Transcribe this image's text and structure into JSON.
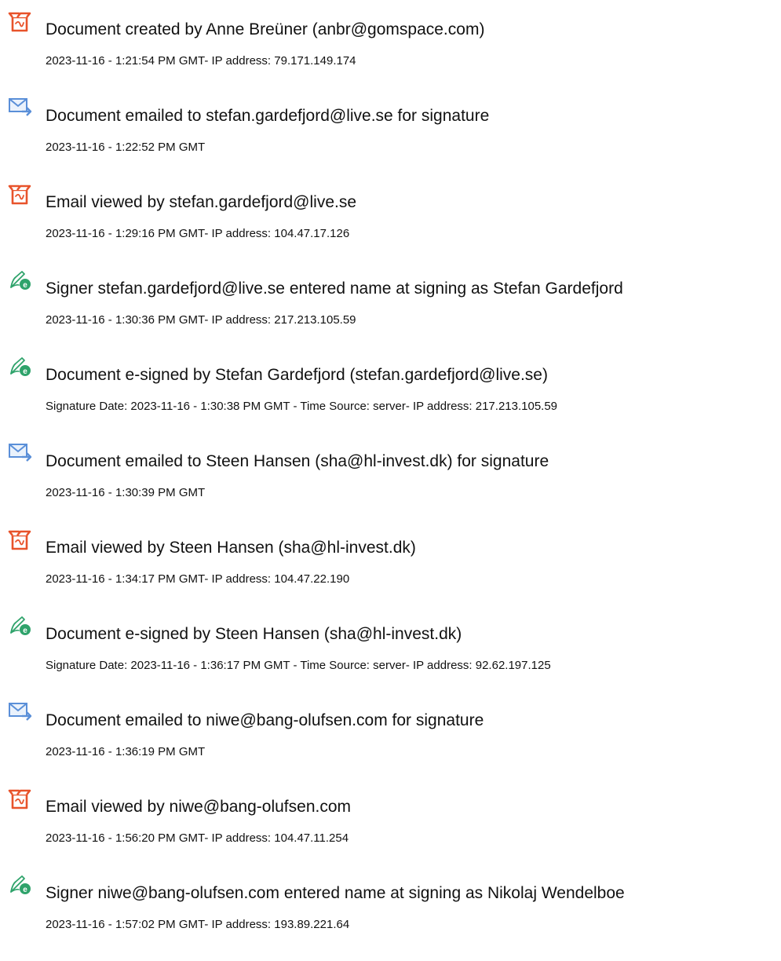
{
  "audit_trail": {
    "events": [
      {
        "icon": "document-created-icon",
        "title": "Document created by Anne Breüner (anbr@gomspace.com)",
        "detail": "2023-11-16 - 1:21:54 PM GMT- IP address: 79.171.149.174"
      },
      {
        "icon": "email-sent-icon",
        "title": "Document emailed to stefan.gardefjord@live.se for signature",
        "detail": "2023-11-16 - 1:22:52 PM GMT"
      },
      {
        "icon": "document-viewed-icon",
        "title": "Email viewed by stefan.gardefjord@live.se",
        "detail": "2023-11-16 - 1:29:16 PM GMT- IP address: 104.47.17.126"
      },
      {
        "icon": "e-sign-icon",
        "title": "Signer stefan.gardefjord@live.se entered name at signing as Stefan Gardefjord",
        "detail": "2023-11-16 - 1:30:36 PM GMT- IP address: 217.213.105.59"
      },
      {
        "icon": "e-sign-icon",
        "title": "Document e-signed by Stefan Gardefjord (stefan.gardefjord@live.se)",
        "detail": "Signature Date: 2023-11-16 - 1:30:38 PM GMT - Time Source: server- IP address: 217.213.105.59"
      },
      {
        "icon": "email-sent-icon",
        "title": "Document emailed to Steen Hansen (sha@hl-invest.dk) for signature",
        "detail": "2023-11-16 - 1:30:39 PM GMT"
      },
      {
        "icon": "document-viewed-icon",
        "title": "Email viewed by Steen Hansen (sha@hl-invest.dk)",
        "detail": "2023-11-16 - 1:34:17 PM GMT- IP address: 104.47.22.190"
      },
      {
        "icon": "e-sign-icon",
        "title": "Document e-signed by Steen Hansen (sha@hl-invest.dk)",
        "detail": "Signature Date: 2023-11-16 - 1:36:17 PM GMT - Time Source: server- IP address: 92.62.197.125"
      },
      {
        "icon": "email-sent-icon",
        "title": "Document emailed to niwe@bang-olufsen.com for signature",
        "detail": "2023-11-16 - 1:36:19 PM GMT"
      },
      {
        "icon": "document-viewed-icon",
        "title": "Email viewed by niwe@bang-olufsen.com",
        "detail": "2023-11-16 - 1:56:20 PM GMT- IP address: 104.47.11.254"
      },
      {
        "icon": "e-sign-icon",
        "title": "Signer niwe@bang-olufsen.com entered name at signing as Nikolaj Wendelboe",
        "detail": "2023-11-16 - 1:57:02 PM GMT- IP address: 193.89.221.64"
      }
    ]
  },
  "colors": {
    "acrobat_red": "#e8532b",
    "mail_blue": "#5a8fd8",
    "sign_green": "#2fa36b",
    "text": "#111111"
  }
}
